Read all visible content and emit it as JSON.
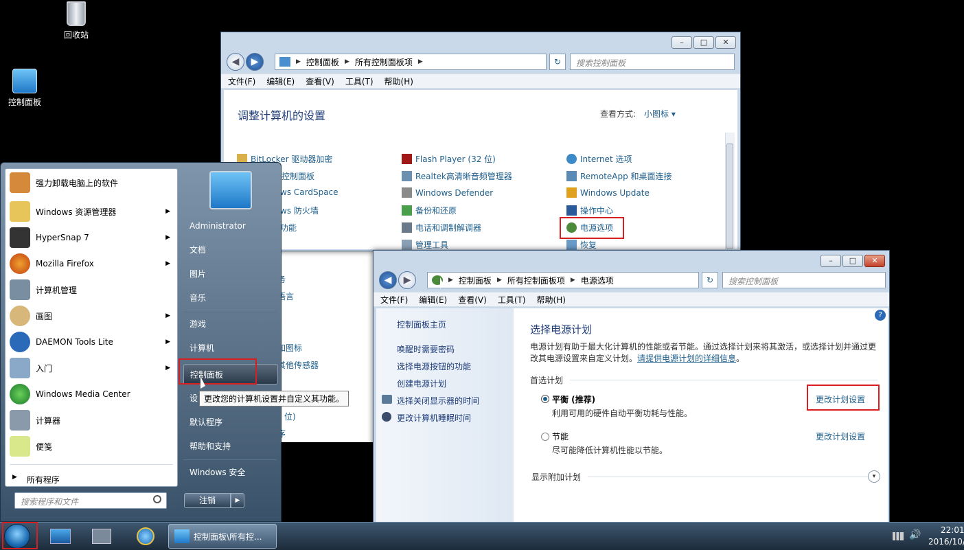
{
  "desktop": {
    "recycle_bin": "回收站",
    "control_panel": "控制面板"
  },
  "back_window": {
    "breadcrumb": [
      "控制面板",
      "所有控制面板项"
    ],
    "search_placeholder": "搜索控制面板",
    "menu": [
      "文件(F)",
      "编辑(E)",
      "查看(V)",
      "工具(T)",
      "帮助(H)"
    ],
    "heading": "调整计算机的设置",
    "view_label": "查看方式:",
    "view_value": "小图标",
    "col1": [
      "BitLocker 驱动器加密",
      "控制面板",
      "ws CardSpace",
      "ws 防火墙",
      "功能",
      "",
      "",
      "",
      "务",
      "语言",
      "",
      "",
      "",
      "知图标",
      "其他传感器",
      "",
      "",
      "位)",
      "序"
    ],
    "col2": [
      "Flash Player (32 位)",
      "Realtek高清晰音频管理器",
      "Windows Defender",
      "备份和还原",
      "电话和调制解调器",
      "管理工具"
    ],
    "col3": [
      "Internet 选项",
      "RemoteApp 和桌面连接",
      "Windows Update",
      "操作中心",
      "电源选项",
      "恢复"
    ]
  },
  "front_window": {
    "breadcrumb": [
      "控制面板",
      "所有控制面板项",
      "电源选项"
    ],
    "search_placeholder": "搜索控制面板",
    "menu": [
      "文件(F)",
      "编辑(E)",
      "查看(V)",
      "工具(T)",
      "帮助(H)"
    ],
    "sidebar": [
      "控制面板主页",
      "唤醒时需要密码",
      "选择电源按钮的功能",
      "创建电源计划",
      "选择关闭显示器的时间",
      "更改计算机睡眠时间"
    ],
    "heading": "选择电源计划",
    "desc1": "电源计划有助于最大化计算机的性能或者节能。通过选择计划来将其激活，或选择计划并通过更",
    "desc2": "改其电源设置来自定义计划。",
    "desc_link": "请提供电源计划的详细信息",
    "desc_end": "。",
    "preferred_label": "首选计划",
    "plan1_name": "平衡 (推荐)",
    "plan1_desc": "利用可用的硬件自动平衡功耗与性能。",
    "plan2_name": "节能",
    "plan2_desc": "尽可能降低计算机性能以节能。",
    "change_link": "更改计划设置",
    "more_plans": "显示附加计划"
  },
  "start_menu": {
    "programs": [
      "强力卸载电脑上的软件",
      "Windows 资源管理器",
      "HyperSnap 7",
      "Mozilla Firefox",
      "计算机管理",
      "画图",
      "DAEMON Tools Lite",
      "入门",
      "Windows Media Center",
      "计算器",
      "便笺"
    ],
    "all_programs": "所有程序",
    "search_placeholder": "搜索程序和文件",
    "right": [
      "Administrator",
      "文档",
      "图片",
      "音乐",
      "游戏",
      "计算机",
      "控制面板",
      "设",
      "默认程序",
      "帮助和支持",
      "Windows 安全"
    ],
    "shutdown": "注销",
    "tooltip": "更改您的计算机设置并自定义其功能。"
  },
  "taskbar": {
    "task_label": "控制面板\\所有控...",
    "time": "22:01",
    "date": "2016/10/"
  }
}
